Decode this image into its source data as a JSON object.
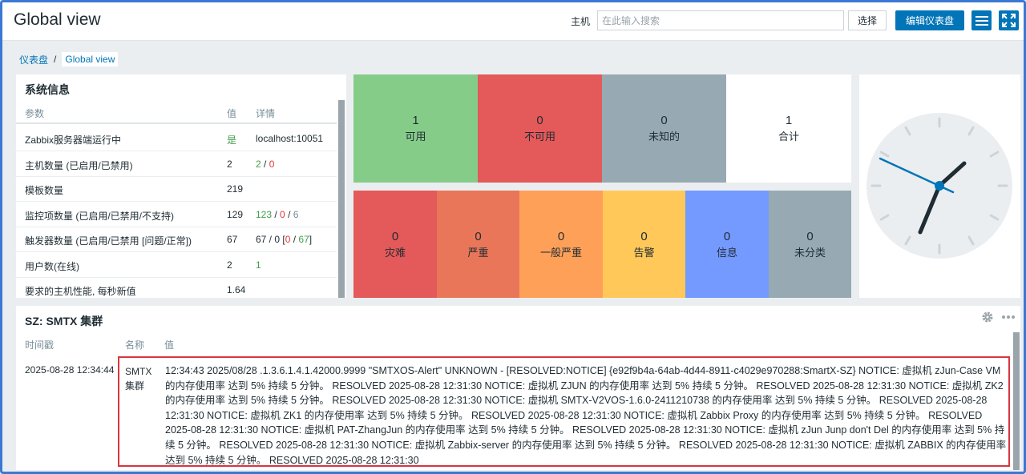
{
  "header": {
    "title": "Global view",
    "host_label": "主机",
    "host_placeholder": "在此输入搜索",
    "select_label": "选择",
    "edit_label": "编辑仪表盘"
  },
  "breadcrumb": {
    "parent": "仪表盘",
    "separator": "/",
    "current": "Global view"
  },
  "sysinfo": {
    "title": "系统信息",
    "columns": [
      "参数",
      "值",
      "详情"
    ],
    "rows": [
      {
        "param": "Zabbix服务器端运行中",
        "value": "是",
        "detail": "localhost:10051"
      },
      {
        "param": "主机数量 (已启用/已禁用)",
        "value": "2",
        "d1": "2",
        "sep1": " / ",
        "d2": "0"
      },
      {
        "param": "模板数量",
        "value": "219"
      },
      {
        "param": "监控项数量 (已启用/已禁用/不支持)",
        "value": "129",
        "d1": "123",
        "sep1": " / ",
        "d2": "0",
        "sep2": " / ",
        "d3": "6"
      },
      {
        "param": "触发器数量 (已启用/已禁用 [问题/正常])",
        "value": "67",
        "d0": "67 / 0 [",
        "d2": "0",
        "sep2": " / ",
        "d1": "67",
        "end": "]"
      },
      {
        "param": "用户数(在线)",
        "value": "2",
        "d1": "1"
      },
      {
        "param": "要求的主机性能, 每秒新值",
        "value": "1.64"
      }
    ]
  },
  "availability": [
    {
      "count": "1",
      "label": "可用",
      "color": "#86cc89"
    },
    {
      "count": "0",
      "label": "不可用",
      "color": "#e45959"
    },
    {
      "count": "0",
      "label": "未知的",
      "color": "#97aab3"
    },
    {
      "count": "1",
      "label": "合计",
      "color": "#ffffff"
    }
  ],
  "severities": [
    {
      "count": "0",
      "label": "灾难",
      "color": "#e45959"
    },
    {
      "count": "0",
      "label": "严重",
      "color": "#e97659"
    },
    {
      "count": "0",
      "label": "一般严重",
      "color": "#ffa059"
    },
    {
      "count": "0",
      "label": "告警",
      "color": "#ffc859"
    },
    {
      "count": "0",
      "label": "信息",
      "color": "#7499ff"
    },
    {
      "count": "0",
      "label": "未分类",
      "color": "#97aab3"
    }
  ],
  "sz": {
    "title": "SZ: SMTX 集群",
    "columns": [
      "时间戳",
      "名称",
      "值"
    ],
    "timestamp": "2025-08-28 12:34:44",
    "name": "SMTX集群",
    "value": "12:34:43 2025/08/28 .1.3.6.1.4.1.42000.9999 \"SMTXOS-Alert\" UNKNOWN - [RESOLVED:NOTICE] {e92f9b4a-64ab-4d44-8911-c4029e970288:SmartX-SZ} NOTICE: 虚拟机 zJun-Case VM 的内存使用率 达到 5% 持续 5 分钟。 RESOLVED 2025-08-28 12:31:30 NOTICE: 虚拟机 ZJUN 的内存使用率 达到 5% 持续 5 分钟。 RESOLVED 2025-08-28 12:31:30 NOTICE: 虚拟机 ZK2 的内存使用率 达到 5% 持续 5 分钟。 RESOLVED 2025-08-28 12:31:30 NOTICE: 虚拟机 SMTX-V2VOS-1.6.0-2411210738 的内存使用率 达到 5% 持续 5 分钟。 RESOLVED 2025-08-28 12:31:30 NOTICE: 虚拟机 ZK1 的内存使用率 达到 5% 持续 5 分钟。 RESOLVED 2025-08-28 12:31:30 NOTICE: 虚拟机 Zabbix Proxy 的内存使用率 达到 5% 持续 5 分钟。 RESOLVED 2025-08-28 12:31:30 NOTICE: 虚拟机 PAT-ZhangJun 的内存使用率 达到 5% 持续 5 分钟。 RESOLVED 2025-08-28 12:31:30 NOTICE: 虚拟机 zJun Junp don't Del 的内存使用率 达到 5% 持续 5 分钟。 RESOLVED 2025-08-28 12:31:30 NOTICE: 虚拟机 Zabbix-server 的内存使用率 达到 5% 持续 5 分钟。 RESOLVED 2025-08-28 12:31:30 NOTICE: 虚拟机 ZABBIX 的内存使用率 达到 5% 持续 5 分钟。 RESOLVED 2025-08-28 12:31:30"
  },
  "colors": {
    "accent": "#0275b8",
    "ok": "#429e47",
    "problem": "#e33734",
    "muted": "#768d99",
    "highlight_border": "#d9363e"
  }
}
